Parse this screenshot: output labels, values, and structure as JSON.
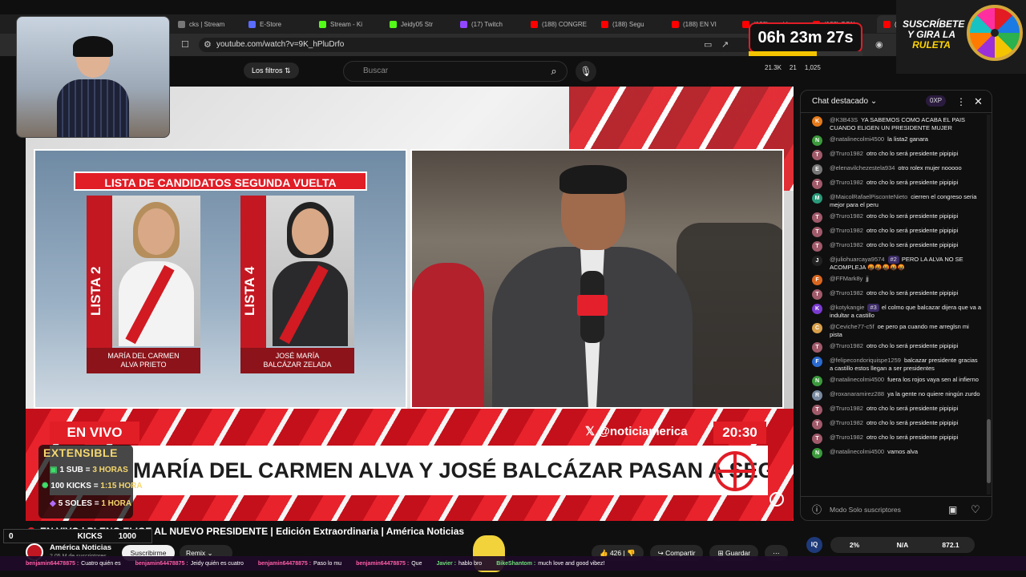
{
  "browser": {
    "tabs": [
      {
        "label": "cks | Stream",
        "color": "#777777"
      },
      {
        "label": "E-Store",
        "color": "#5b6cff"
      },
      {
        "label": "Stream - Ki",
        "color": "#53fc18"
      },
      {
        "label": "Jeidy05 Str",
        "color": "#53fc18"
      },
      {
        "label": "(17) Twitch",
        "color": "#9146ff"
      },
      {
        "label": "(188) CONGRE",
        "color": "#ff0000"
      },
      {
        "label": "(188) Segu",
        "color": "#ff0000"
      },
      {
        "label": "(188) EN VI",
        "color": "#ff0000"
      },
      {
        "label": "(188) preside",
        "color": "#ff0000"
      },
      {
        "label": "(188) CON",
        "color": "#ff0000"
      },
      {
        "label": "(188)",
        "color": "#ff0000"
      }
    ],
    "url": "youtube.com/watch?v=9K_hPluDrfo"
  },
  "youtube": {
    "filters_label": "Los filtros",
    "search_placeholder": "Buscar",
    "stats": [
      "21.3K",
      "21",
      "1,025"
    ]
  },
  "overlay": {
    "timer": "06h 23m 27s",
    "timer_progress": 0.6,
    "ruleta_line1": "SUSCRÍBETE",
    "ruleta_line2": "Y GIRA LA",
    "ruleta_line3": "RULETA"
  },
  "broadcast": {
    "list_title": "LISTA DE CANDIDATOS SEGUNDA VUELTA",
    "candidates": [
      {
        "list": "LISTA 2",
        "name_line1": "MARÍA DEL CARMEN",
        "name_line2": "ALVA PRIETO"
      },
      {
        "list": "LISTA 4",
        "name_line1": "JOSÉ MARÍA",
        "name_line2": "BALCÁZAR ZELADA"
      }
    ],
    "live_label": "EN VIVO",
    "handle": "𝕏 @noticiamerica",
    "time": "20:30",
    "headline": "MARÍA DEL CARMEN ALVA Y JOSÉ BALCÁZAR PASAN A SEGUNDA VUELTA"
  },
  "extensible": {
    "title": "EXTENSIBLE",
    "rows": [
      {
        "left": "1 SUB = ",
        "right": "3 HORAS"
      },
      {
        "left": "100 KICKS = ",
        "right": "1:15 HORA"
      },
      {
        "left": "5 SOLES = ",
        "right": "1 HORA"
      }
    ]
  },
  "chat": {
    "title": "Chat destacado",
    "xp": "0XP",
    "messages": [
      {
        "author": "@K3B43S",
        "text": "YA SABEMOS COMO ACABA EL PAIS CUANDO ELIGEN UN PRESIDENTE MUJER",
        "avatar": "K",
        "color": "#e57a1a",
        "badge": ""
      },
      {
        "author": "@natalinecolmi4500",
        "text": "la lista2 ganara",
        "avatar": "N",
        "color": "#3c9a3c",
        "badge": ""
      },
      {
        "author": "@Truro1982",
        "text": "otro cho lo será presidente pipipipi",
        "avatar": "T",
        "color": "#a05a6a",
        "badge": ""
      },
      {
        "author": "@elenavilchezestela934",
        "text": "otro rolex mujer nooooo",
        "avatar": "E",
        "color": "#777777",
        "badge": ""
      },
      {
        "author": "@Truro1982",
        "text": "otro cho lo será presidente pipipipi",
        "avatar": "T",
        "color": "#a05a6a",
        "badge": ""
      },
      {
        "author": "@MaicolRafaelPiscontеNieto",
        "text": "cierren el congreso seria mejor para el peru",
        "avatar": "M",
        "color": "#2a9a7a",
        "badge": ""
      },
      {
        "author": "@Truro1982",
        "text": "otro cho lo será presidente pipipipi",
        "avatar": "T",
        "color": "#a05a6a",
        "badge": ""
      },
      {
        "author": "@Truro1982",
        "text": "otro cho lo será presidente pipipipi",
        "avatar": "T",
        "color": "#a05a6a",
        "badge": ""
      },
      {
        "author": "@Truro1982",
        "text": "otro cho lo será presidente pipipipi",
        "avatar": "T",
        "color": "#a05a6a",
        "badge": ""
      },
      {
        "author": "@juliohuarcaya9574",
        "text": "PERO LA ALVA NO SE ACOMPLEJA 🤬🤬🤬🤬🤬",
        "avatar": "J",
        "color": "#222222",
        "badge": "#2"
      },
      {
        "author": "@FFMark8y",
        "text": "jj",
        "avatar": "F",
        "color": "#d9661f",
        "badge": ""
      },
      {
        "author": "@Truro1982",
        "text": "otro cho lo será presidente pipipipi",
        "avatar": "T",
        "color": "#a05a6a",
        "badge": ""
      },
      {
        "author": "@kotykangie",
        "text": "el colmo que balcazar dijera que va a indultar a castillo",
        "avatar": "K",
        "color": "#7a3ad0",
        "badge": "#3"
      },
      {
        "author": "@Ceviche77-c5f",
        "text": "oe pero pa cuando me arreglsn mi pista",
        "avatar": "C",
        "color": "#d9a04a",
        "badge": ""
      },
      {
        "author": "@Truro1982",
        "text": "otro cho lo será presidente pipipipi",
        "avatar": "T",
        "color": "#a05a6a",
        "badge": ""
      },
      {
        "author": "@felipecondoriquispe1259",
        "text": "balcazar presidente gracias a castillo estos llegan a ser presidentes",
        "avatar": "F",
        "color": "#2a6ad0",
        "badge": ""
      },
      {
        "author": "@natalinecolmi4500",
        "text": "fuera los rojos vaya sen al infierno",
        "avatar": "N",
        "color": "#3c9a3c",
        "badge": ""
      },
      {
        "author": "@roxanaramirez288",
        "text": "ya la gente no quiere ningún zurdo",
        "avatar": "R",
        "color": "#7a8aa0",
        "badge": ""
      },
      {
        "author": "@Truro1982",
        "text": "otro cho lo será presidente pipipipi",
        "avatar": "T",
        "color": "#a05a6a",
        "badge": ""
      },
      {
        "author": "@Truro1982",
        "text": "otro cho lo será presidente pipipipi",
        "avatar": "T",
        "color": "#a05a6a",
        "badge": ""
      },
      {
        "author": "@Truro1982",
        "text": "otro cho lo será presidente pipipipi",
        "avatar": "T",
        "color": "#a05a6a",
        "badge": ""
      },
      {
        "author": "@natalinecolmi4500",
        "text": "vamos alva",
        "avatar": "N",
        "color": "#3c9a3c",
        "badge": ""
      }
    ],
    "footer": "Modo Solo suscriptores"
  },
  "video_info": {
    "title": "EN VIVO | PLENO ELIGE AL NUEVO PRESIDENTE | Edición Extraordinaria | América Noticias",
    "kicks_left": "0",
    "kicks_label": "KICKS",
    "kicks_right": "1000",
    "channel": "América Noticias",
    "subscribers": "2.05 M de suscriptores",
    "subscribe": "Suscribirme",
    "remix": "Remix",
    "likes": "426",
    "share": "Compartir",
    "save": "Guardar",
    "percent": [
      "2%",
      "N/A",
      "872.1"
    ]
  },
  "ticker": [
    {
      "user": "benjamin64478875 :",
      "text": "Cuatro quién es"
    },
    {
      "user": "benjamin64478875 :",
      "text": "Jeidy quién es cuatro"
    },
    {
      "user": "benjamin64478875 :",
      "text": "Paso lo mu"
    },
    {
      "user": "benjamin64478875 :",
      "text": "Que"
    },
    {
      "user": "Javier :",
      "text": "hablo bro"
    },
    {
      "user": "BikeShantom :",
      "text": "much love and good vibez!"
    }
  ]
}
